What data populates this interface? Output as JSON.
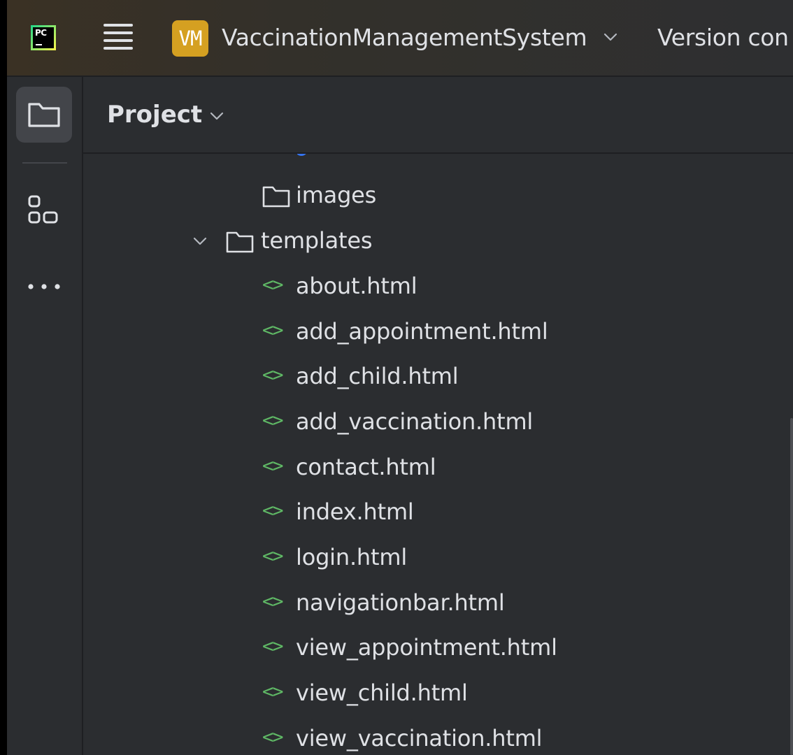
{
  "titlebar": {
    "ide_logo_text": "PC",
    "project_badge": "VM",
    "project_name": "VaccinationManagementSystem",
    "vcs_label": "Version con"
  },
  "toolstripe": {
    "items": [
      {
        "icon": "folder-icon",
        "label": "Project",
        "active": true
      },
      {
        "icon": "structure-icon",
        "label": "Structure",
        "active": false
      },
      {
        "icon": "more-icon",
        "label": "More",
        "active": false
      }
    ]
  },
  "panel": {
    "title": "Project"
  },
  "tree": {
    "rows": [
      {
        "type": "folder",
        "label": "images",
        "expanded": false
      },
      {
        "type": "folder",
        "label": "templates",
        "expanded": true
      },
      {
        "type": "file",
        "label": "about.html"
      },
      {
        "type": "file",
        "label": "add_appointment.html"
      },
      {
        "type": "file",
        "label": "add_child.html"
      },
      {
        "type": "file",
        "label": "add_vaccination.html"
      },
      {
        "type": "file",
        "label": "contact.html"
      },
      {
        "type": "file",
        "label": "index.html"
      },
      {
        "type": "file",
        "label": "login.html"
      },
      {
        "type": "file",
        "label": "navigationbar.html"
      },
      {
        "type": "file",
        "label": "view_appointment.html"
      },
      {
        "type": "file",
        "label": "view_child.html"
      },
      {
        "type": "file",
        "label": "view_vaccination.html"
      }
    ]
  },
  "colors": {
    "background": "#2b2d30",
    "text": "#dfe1e5",
    "html_icon": "#5fb865",
    "project_badge": "#d5a021",
    "active_tool": "#43454a"
  }
}
